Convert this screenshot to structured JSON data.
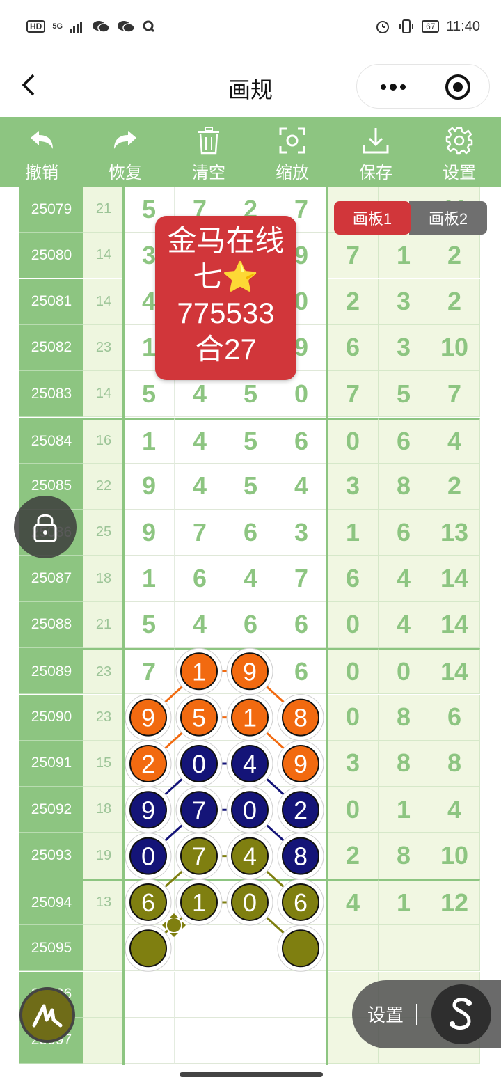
{
  "status_bar": {
    "hd": "HD",
    "signal": "5G",
    "battery": "67",
    "time": "11:40"
  },
  "header": {
    "title": "画规",
    "back_icon": "chevron-left-icon",
    "more_icon": "more-dots-icon",
    "target_icon": "target-circle-icon"
  },
  "toolbar": [
    {
      "label": "撤销",
      "icon": "undo-icon"
    },
    {
      "label": "恢复",
      "icon": "redo-icon"
    },
    {
      "label": "清空",
      "icon": "trash-icon"
    },
    {
      "label": "缩放",
      "icon": "zoom-icon"
    },
    {
      "label": "保存",
      "icon": "download-icon"
    },
    {
      "label": "设置",
      "icon": "gear-icon"
    }
  ],
  "rows": [
    {
      "issue": "25079",
      "sum": "21",
      "digits": [
        "5",
        "7",
        "2",
        "7"
      ],
      "right": [
        "",
        "",
        "11"
      ]
    },
    {
      "issue": "25080",
      "sum": "14",
      "digits": [
        "3",
        "",
        "",
        "9"
      ],
      "right": [
        "7",
        "1",
        "2"
      ]
    },
    {
      "issue": "25081",
      "sum": "14",
      "digits": [
        "4",
        "",
        "",
        "0"
      ],
      "right": [
        "2",
        "3",
        "2"
      ]
    },
    {
      "issue": "25082",
      "sum": "23",
      "digits": [
        "1",
        "",
        "",
        "9"
      ],
      "right": [
        "6",
        "3",
        "10"
      ]
    },
    {
      "issue": "25083",
      "sum": "14",
      "digits": [
        "5",
        "4",
        "5",
        "0"
      ],
      "right": [
        "7",
        "5",
        "7"
      ]
    },
    {
      "issue": "25084",
      "sum": "16",
      "digits": [
        "1",
        "4",
        "5",
        "6"
      ],
      "right": [
        "0",
        "6",
        "4"
      ]
    },
    {
      "issue": "25085",
      "sum": "22",
      "digits": [
        "9",
        "4",
        "5",
        "4"
      ],
      "right": [
        "3",
        "8",
        "2"
      ]
    },
    {
      "issue": "25086",
      "sum": "25",
      "digits": [
        "9",
        "7",
        "6",
        "3"
      ],
      "right": [
        "1",
        "6",
        "13"
      ]
    },
    {
      "issue": "25087",
      "sum": "18",
      "digits": [
        "1",
        "6",
        "4",
        "7"
      ],
      "right": [
        "6",
        "4",
        "14"
      ]
    },
    {
      "issue": "25088",
      "sum": "21",
      "digits": [
        "5",
        "4",
        "6",
        "6"
      ],
      "right": [
        "0",
        "4",
        "14"
      ]
    },
    {
      "issue": "25089",
      "sum": "23",
      "digits": [
        "7",
        "1",
        "9",
        "6"
      ],
      "right": [
        "0",
        "0",
        "14"
      ]
    },
    {
      "issue": "25090",
      "sum": "23",
      "digits": [
        "9",
        "5",
        "1",
        "8"
      ],
      "right": [
        "0",
        "8",
        "6"
      ]
    },
    {
      "issue": "25091",
      "sum": "15",
      "digits": [
        "2",
        "0",
        "4",
        "9"
      ],
      "right": [
        "3",
        "8",
        "8"
      ]
    },
    {
      "issue": "25092",
      "sum": "18",
      "digits": [
        "9",
        "7",
        "0",
        "2"
      ],
      "right": [
        "0",
        "1",
        "4"
      ]
    },
    {
      "issue": "25093",
      "sum": "19",
      "digits": [
        "0",
        "7",
        "4",
        "8"
      ],
      "right": [
        "2",
        "8",
        "10"
      ]
    },
    {
      "issue": "25094",
      "sum": "13",
      "digits": [
        "6",
        "1",
        "0",
        "6"
      ],
      "right": [
        "4",
        "1",
        "12"
      ]
    },
    {
      "issue": "25095",
      "sum": "",
      "digits": [
        "",
        "",
        "",
        ""
      ],
      "right": [
        "",
        "",
        ""
      ]
    },
    {
      "issue": "25096",
      "sum": "",
      "digits": [
        "",
        "",
        "",
        ""
      ],
      "right": [
        "",
        "",
        ""
      ]
    },
    {
      "issue": "25097",
      "sum": "",
      "digits": [
        "",
        "",
        "",
        ""
      ],
      "right": [
        "",
        "",
        ""
      ]
    }
  ],
  "markers": {
    "colors": {
      "orange": "#f26a10",
      "navy": "#141478",
      "olive": "#7f7f10"
    },
    "balls": [
      {
        "row": 10,
        "col": 1,
        "text": "1",
        "color": "orange"
      },
      {
        "row": 10,
        "col": 2,
        "text": "9",
        "color": "orange"
      },
      {
        "row": 11,
        "col": 0,
        "text": "9",
        "color": "orange"
      },
      {
        "row": 11,
        "col": 1,
        "text": "5",
        "color": "orange"
      },
      {
        "row": 11,
        "col": 2,
        "text": "1",
        "color": "orange"
      },
      {
        "row": 11,
        "col": 3,
        "text": "8",
        "color": "orange"
      },
      {
        "row": 12,
        "col": 0,
        "text": "2",
        "color": "orange"
      },
      {
        "row": 12,
        "col": 3,
        "text": "9",
        "color": "orange"
      },
      {
        "row": 12,
        "col": 1,
        "text": "0",
        "color": "navy"
      },
      {
        "row": 12,
        "col": 2,
        "text": "4",
        "color": "navy"
      },
      {
        "row": 13,
        "col": 0,
        "text": "9",
        "color": "navy"
      },
      {
        "row": 13,
        "col": 1,
        "text": "7",
        "color": "navy"
      },
      {
        "row": 13,
        "col": 2,
        "text": "0",
        "color": "navy"
      },
      {
        "row": 13,
        "col": 3,
        "text": "2",
        "color": "navy"
      },
      {
        "row": 14,
        "col": 0,
        "text": "0",
        "color": "navy"
      },
      {
        "row": 14,
        "col": 3,
        "text": "8",
        "color": "navy"
      },
      {
        "row": 14,
        "col": 1,
        "text": "7",
        "color": "olive"
      },
      {
        "row": 14,
        "col": 2,
        "text": "4",
        "color": "olive"
      },
      {
        "row": 15,
        "col": 0,
        "text": "6",
        "color": "olive"
      },
      {
        "row": 15,
        "col": 1,
        "text": "1",
        "color": "olive"
      },
      {
        "row": 15,
        "col": 2,
        "text": "0",
        "color": "olive"
      },
      {
        "row": 15,
        "col": 3,
        "text": "6",
        "color": "olive"
      },
      {
        "row": 16,
        "col": 0,
        "text": "",
        "color": "olive"
      },
      {
        "row": 16,
        "col": 3,
        "text": "",
        "color": "olive"
      }
    ],
    "lines": [
      {
        "from": [
          10,
          1
        ],
        "to": [
          10,
          2
        ],
        "color": "orange"
      },
      {
        "from": [
          10,
          1
        ],
        "to": [
          11,
          0
        ],
        "color": "orange"
      },
      {
        "from": [
          10,
          2
        ],
        "to": [
          11,
          3
        ],
        "color": "orange"
      },
      {
        "from": [
          11,
          1
        ],
        "to": [
          11,
          2
        ],
        "color": "orange"
      },
      {
        "from": [
          11,
          1
        ],
        "to": [
          12,
          0
        ],
        "color": "orange"
      },
      {
        "from": [
          11,
          2
        ],
        "to": [
          12,
          3
        ],
        "color": "orange"
      },
      {
        "from": [
          12,
          1
        ],
        "to": [
          12,
          2
        ],
        "color": "navy"
      },
      {
        "from": [
          12,
          1
        ],
        "to": [
          13,
          0
        ],
        "color": "navy"
      },
      {
        "from": [
          12,
          2
        ],
        "to": [
          13,
          3
        ],
        "color": "navy"
      },
      {
        "from": [
          13,
          1
        ],
        "to": [
          13,
          2
        ],
        "color": "navy"
      },
      {
        "from": [
          13,
          1
        ],
        "to": [
          14,
          0
        ],
        "color": "navy"
      },
      {
        "from": [
          13,
          2
        ],
        "to": [
          14,
          3
        ],
        "color": "navy"
      },
      {
        "from": [
          14,
          1
        ],
        "to": [
          14,
          2
        ],
        "color": "olive"
      },
      {
        "from": [
          14,
          1
        ],
        "to": [
          15,
          0
        ],
        "color": "olive"
      },
      {
        "from": [
          14,
          2
        ],
        "to": [
          15,
          3
        ],
        "color": "olive"
      },
      {
        "from": [
          15,
          1
        ],
        "to": [
          15,
          2
        ],
        "color": "olive"
      },
      {
        "from": [
          15,
          1
        ],
        "to": [
          16,
          0
        ],
        "color": "olive"
      },
      {
        "from": [
          15,
          2
        ],
        "to": [
          16,
          3
        ],
        "color": "olive"
      }
    ]
  },
  "promo_card": {
    "line1": "金马在线",
    "line2": "七⭐",
    "line3": "775533",
    "line4": "合27"
  },
  "board_tabs": {
    "tab1": "画板1",
    "tab2": "画板2"
  },
  "floating": {
    "lock_icon": "lock-icon",
    "pen_icon": "pen-scribble-icon",
    "settings_label": "设置",
    "s_icon": "s-logo-icon"
  }
}
